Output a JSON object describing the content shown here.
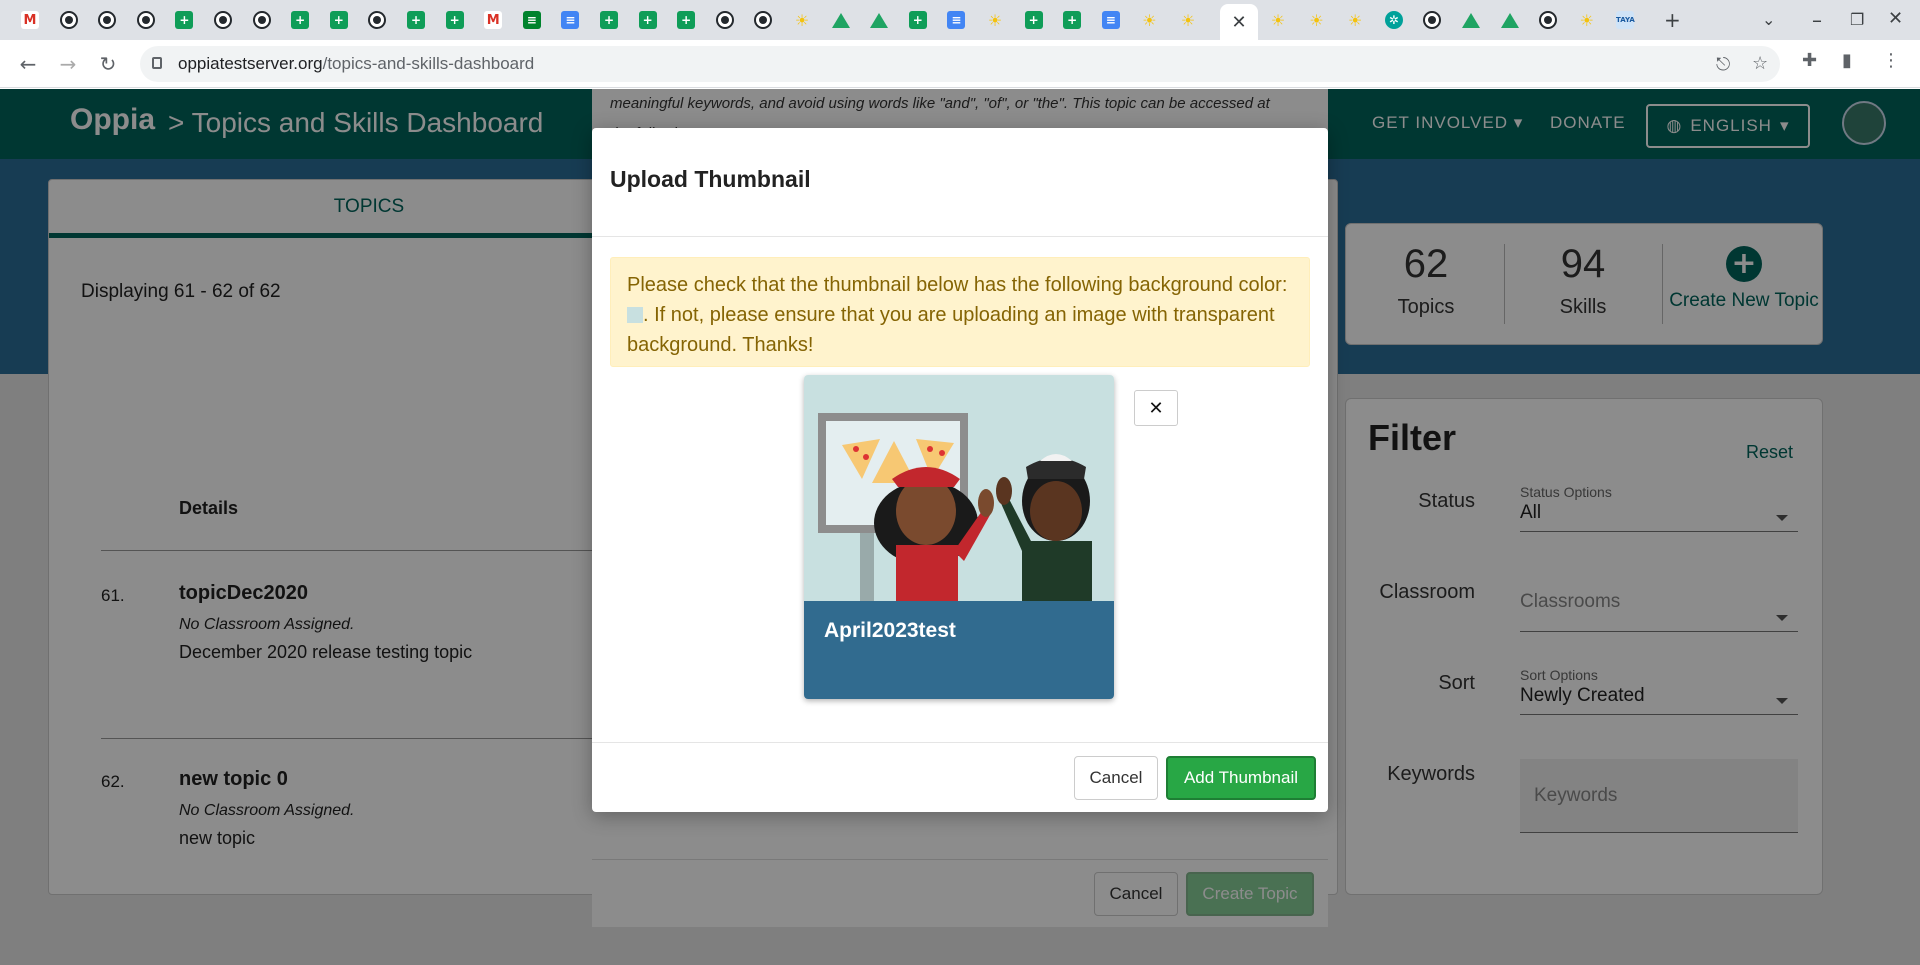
{
  "browser": {
    "tabs": [
      {
        "icon": "gmail-icon",
        "glyph": "M"
      },
      {
        "icon": "github-icon",
        "glyph": ""
      },
      {
        "icon": "github-icon",
        "glyph": ""
      },
      {
        "icon": "github-icon",
        "glyph": ""
      },
      {
        "icon": "sheets-icon",
        "glyph": "+"
      },
      {
        "icon": "github-icon",
        "glyph": ""
      },
      {
        "icon": "github-icon",
        "glyph": ""
      },
      {
        "icon": "sheets-icon",
        "glyph": "+"
      },
      {
        "icon": "sheets-icon",
        "glyph": "+"
      },
      {
        "icon": "github-icon",
        "glyph": ""
      },
      {
        "icon": "sheets-icon",
        "glyph": "+"
      },
      {
        "icon": "sheets-icon",
        "glyph": "+"
      },
      {
        "icon": "gmail-icon",
        "glyph": "M"
      },
      {
        "icon": "chat-icon",
        "glyph": "≡"
      },
      {
        "icon": "docs-icon",
        "glyph": "≡"
      },
      {
        "icon": "sheets-icon",
        "glyph": "+"
      },
      {
        "icon": "sheets-icon",
        "glyph": "+"
      },
      {
        "icon": "sheets-icon",
        "glyph": "+"
      },
      {
        "icon": "github-icon",
        "glyph": ""
      },
      {
        "icon": "github-icon",
        "glyph": ""
      },
      {
        "icon": "lightbulb-icon",
        "glyph": "☀"
      },
      {
        "icon": "drive-icon",
        "glyph": ""
      },
      {
        "icon": "drive-icon",
        "glyph": ""
      },
      {
        "icon": "sheets-icon",
        "glyph": "+"
      },
      {
        "icon": "docs-icon",
        "glyph": "≡"
      },
      {
        "icon": "lightbulb-icon",
        "glyph": "☀"
      },
      {
        "icon": "sheets-icon",
        "glyph": "+"
      },
      {
        "icon": "sheets-icon",
        "glyph": "+"
      },
      {
        "icon": "docs-icon",
        "glyph": "≡"
      },
      {
        "icon": "lightbulb-icon",
        "glyph": "☀"
      },
      {
        "icon": "lightbulb-icon",
        "glyph": "☀"
      }
    ],
    "tabs_after": [
      {
        "icon": "lightbulb-icon",
        "glyph": "☀"
      },
      {
        "icon": "lightbulb-icon",
        "glyph": "☀"
      },
      {
        "icon": "lightbulb-icon",
        "glyph": "☀"
      },
      {
        "icon": "openai-icon",
        "glyph": "✲"
      },
      {
        "icon": "github-icon",
        "glyph": ""
      },
      {
        "icon": "drive-icon",
        "glyph": ""
      },
      {
        "icon": "drive-icon",
        "glyph": ""
      },
      {
        "icon": "github-icon",
        "glyph": ""
      },
      {
        "icon": "lightbulb-icon",
        "glyph": "☀"
      },
      {
        "icon": "taya-icon",
        "glyph": "TAYA"
      }
    ],
    "active_tab_close": "✕",
    "new_tab": "+",
    "url_domain": "oppiatestserver.org",
    "url_path": "/topics-and-skills-dashboard"
  },
  "navbar": {
    "logo": "Oppia",
    "breadcrumb": "> Topics and Skills Dashboard",
    "get_involved": "GET INVOLVED",
    "donate": "DONATE",
    "language": "ENGLISH"
  },
  "topics_panel": {
    "tab_label": "TOPICS",
    "displaying": "Displaying 61 - 62 of 62",
    "details_header": "Details",
    "rows": [
      {
        "index": "61.",
        "name": "topicDec2020",
        "classroom": "No Classroom Assigned.",
        "description": "December 2020 release testing topic"
      },
      {
        "index": "62.",
        "name": "new topic 0",
        "classroom": "No Classroom Assigned.",
        "description": "new topic"
      }
    ]
  },
  "stats": {
    "topics_count": "62",
    "topics_label": "Topics",
    "skills_count": "94",
    "skills_label": "Skills",
    "create_label": "Create New Topic"
  },
  "filter": {
    "title": "Filter",
    "reset": "Reset",
    "status_label": "Status",
    "status_small": "Status Options",
    "status_value": "All",
    "classroom_label": "Classroom",
    "classroom_placeholder": "Classrooms",
    "sort_label": "Sort",
    "sort_small": "Sort Options",
    "sort_value": "Newly Created",
    "keywords_label": "Keywords",
    "keywords_placeholder": "Keywords"
  },
  "background_modal": {
    "text_line1": "meaningful keywords, and avoid using words like \"and\", \"of\", or \"the\". This topic can be accessed at",
    "text_line2": "the following URL:",
    "cancel": "Cancel",
    "create": "Create Topic"
  },
  "upload_modal": {
    "title": "Upload Thumbnail",
    "alert_part1": "Please check that the thumbnail below has the following background color:",
    "alert_part2": ". If not, please ensure that you are uploading an image with transparent background. Thanks!",
    "swatch_color": "#c8e0e0",
    "thumbnail_title": "April2023test",
    "close_glyph": "✕",
    "cancel": "Cancel",
    "add": "Add Thumbnail"
  }
}
